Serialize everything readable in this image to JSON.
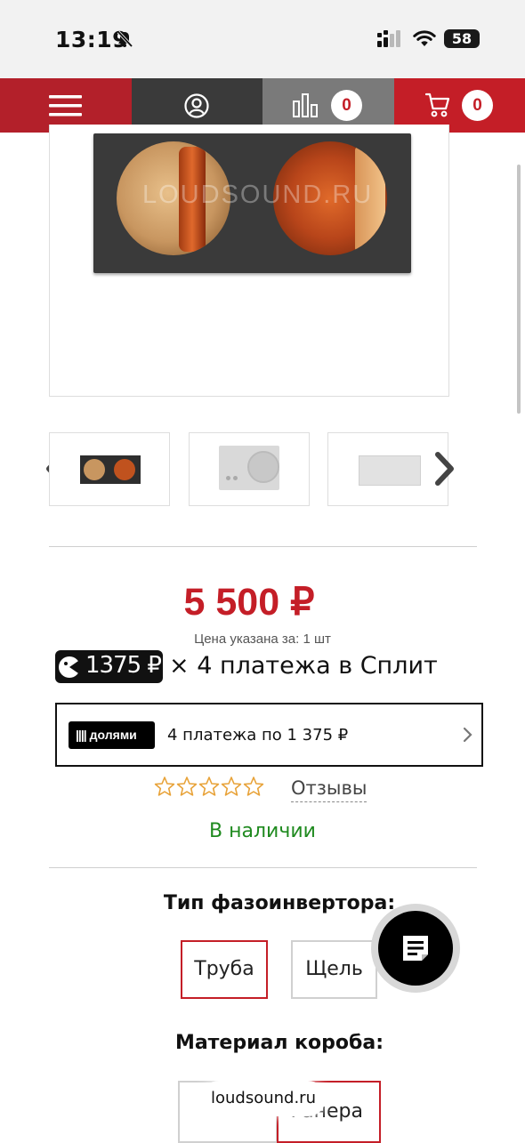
{
  "status_bar": {
    "time": "13:19",
    "battery": "58"
  },
  "nav": {
    "compare_count": "0",
    "cart_count": "0"
  },
  "product_image": {
    "watermark": "LOUDSOUND.RU"
  },
  "price": {
    "value": "5 500 ₽",
    "note": "Цена указана за: 1 шт"
  },
  "split": {
    "amount": "1375 ₽",
    "text": "× 4 платежа в Сплит"
  },
  "dolyami": {
    "logo": "долями",
    "text": "4 платежа по 1 375 ₽"
  },
  "rating": {
    "stars": 0,
    "reviews_label": "Отзывы"
  },
  "stock": "В наличии",
  "options": {
    "port_type": {
      "title": "Тип фазоинвертора:",
      "items": [
        "Труба",
        "Щель"
      ],
      "selected": "Труба"
    },
    "material": {
      "title": "Материал короба:",
      "items": [
        "",
        "Фанера"
      ],
      "selected": "Фанера"
    }
  },
  "browser": {
    "url": "loudsound.ru"
  },
  "colors": {
    "brand_red": "#c41e27",
    "in_stock_green": "#1f8a1f"
  }
}
